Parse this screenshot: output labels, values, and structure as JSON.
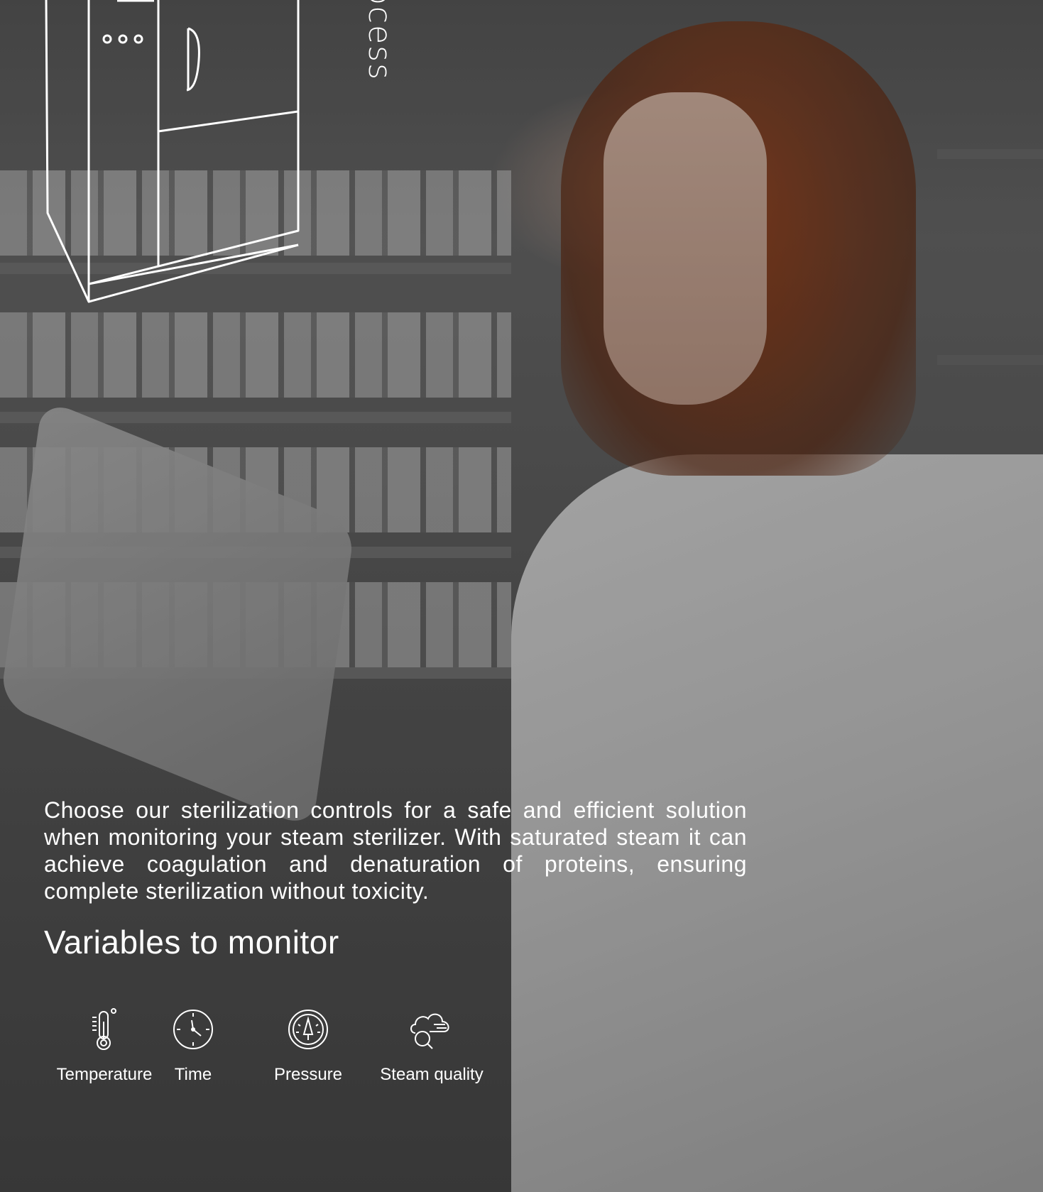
{
  "rotated_text": "ocess",
  "description": "Choose our sterilization controls for a safe and efficient solution when monitoring your steam sterilizer. With saturated steam it can achieve coagulation and denaturation of proteins, ensuring complete sterilization without toxicity.",
  "heading": "Variables to monitor",
  "variables": [
    {
      "label": "Temperature",
      "icon": "thermometer-icon"
    },
    {
      "label": "Time",
      "icon": "clock-icon"
    },
    {
      "label": "Pressure",
      "icon": "gauge-icon"
    },
    {
      "label": "Steam quality",
      "icon": "steam-quality-icon"
    }
  ]
}
